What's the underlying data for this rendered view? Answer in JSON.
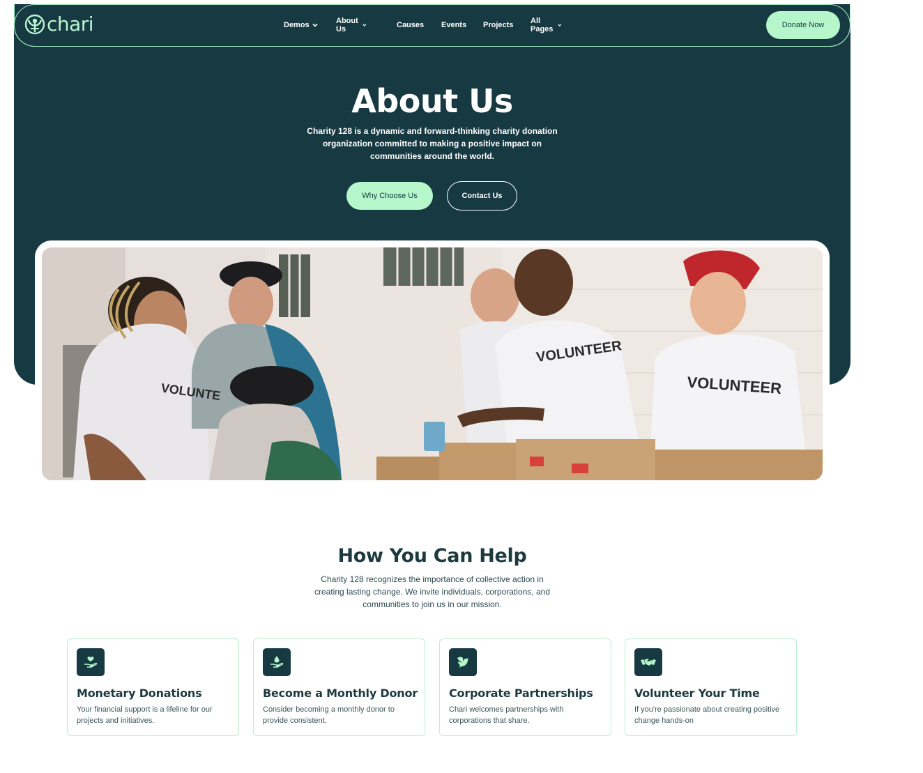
{
  "brand": {
    "name": "chari"
  },
  "nav": {
    "items": [
      {
        "label": "Demos",
        "dropdown": true
      },
      {
        "label": "About Us",
        "dropdown": true
      },
      {
        "label": "Causes",
        "dropdown": false
      },
      {
        "label": "Events",
        "dropdown": false
      },
      {
        "label": "Projects",
        "dropdown": false
      },
      {
        "label": "All Pages",
        "dropdown": true
      }
    ],
    "donate_label": "Donate Now"
  },
  "hero": {
    "title": "About Us",
    "description": "Charity 128 is a dynamic and forward-thinking charity donation organization committed to making a positive impact on communities around the world.",
    "primary_button": "Why Choose Us",
    "secondary_button": "Contact Us"
  },
  "help": {
    "title": "How You Can Help",
    "description": "Charity 128 recognizes the importance of collective action in creating lasting change. We invite individuals, corporations, and communities to join us in our mission.",
    "cards": [
      {
        "icon": "heart-hand-icon",
        "title": "Monetary Donations",
        "text": "Your financial support is a lifeline for our projects and initiatives."
      },
      {
        "icon": "drop-hand-icon",
        "title": "Become a Monthly Donor",
        "text": "Consider becoming a monthly donor to provide consistent."
      },
      {
        "icon": "dove-icon",
        "title": "Corporate Partnerships",
        "text": "Chari welcomes partnerships with corporations that share."
      },
      {
        "icon": "handshake-icon",
        "title": "Volunteer Your Time",
        "text": "If you're passionate about creating positive change hands-on"
      }
    ]
  },
  "colors": {
    "primary_dark": "#173a42",
    "accent_mint": "#b5f6cb",
    "card_border": "#b7efcf"
  }
}
